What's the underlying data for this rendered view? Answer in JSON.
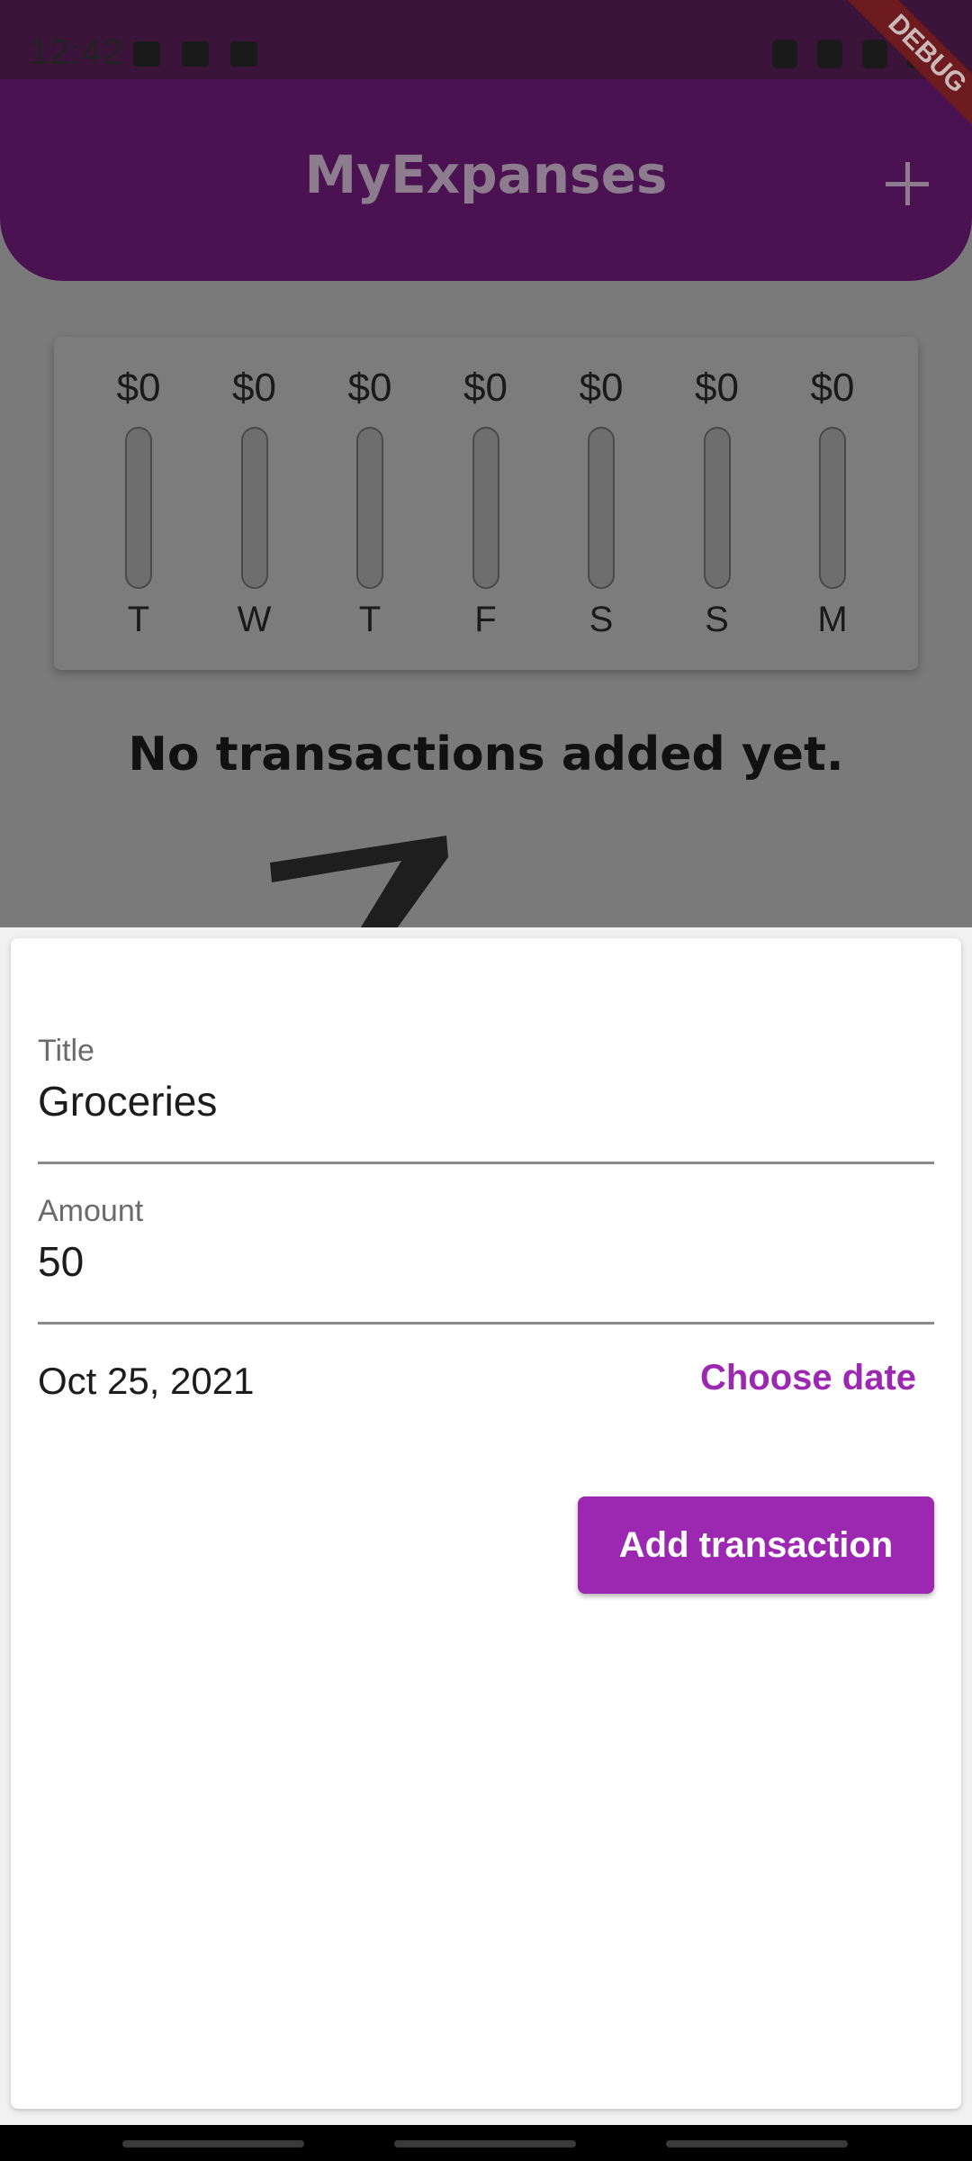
{
  "status_bar": {
    "time": "12:42"
  },
  "debug_banner": {
    "label": "DEBUG"
  },
  "app_bar": {
    "title": "MyExpanses"
  },
  "chart": {
    "bars": [
      {
        "amount": "$0",
        "day": "T",
        "spending_fraction": 0
      },
      {
        "amount": "$0",
        "day": "W",
        "spending_fraction": 0
      },
      {
        "amount": "$0",
        "day": "T",
        "spending_fraction": 0
      },
      {
        "amount": "$0",
        "day": "F",
        "spending_fraction": 0
      },
      {
        "amount": "$0",
        "day": "S",
        "spending_fraction": 0
      },
      {
        "amount": "$0",
        "day": "S",
        "spending_fraction": 0
      },
      {
        "amount": "$0",
        "day": "M",
        "spending_fraction": 0
      }
    ]
  },
  "empty_state": {
    "message": "No transactions added yet."
  },
  "form": {
    "title_field": {
      "label": "Title",
      "value": "Groceries"
    },
    "amount_field": {
      "label": "Amount",
      "value": "50"
    },
    "selected_date": "Oct 25, 2021",
    "choose_date_label": "Choose date",
    "submit_label": "Add transaction"
  },
  "colors": {
    "accent": "#9c27b0",
    "app_bar": "#4a1250",
    "scrim": "#7a7a7a"
  }
}
